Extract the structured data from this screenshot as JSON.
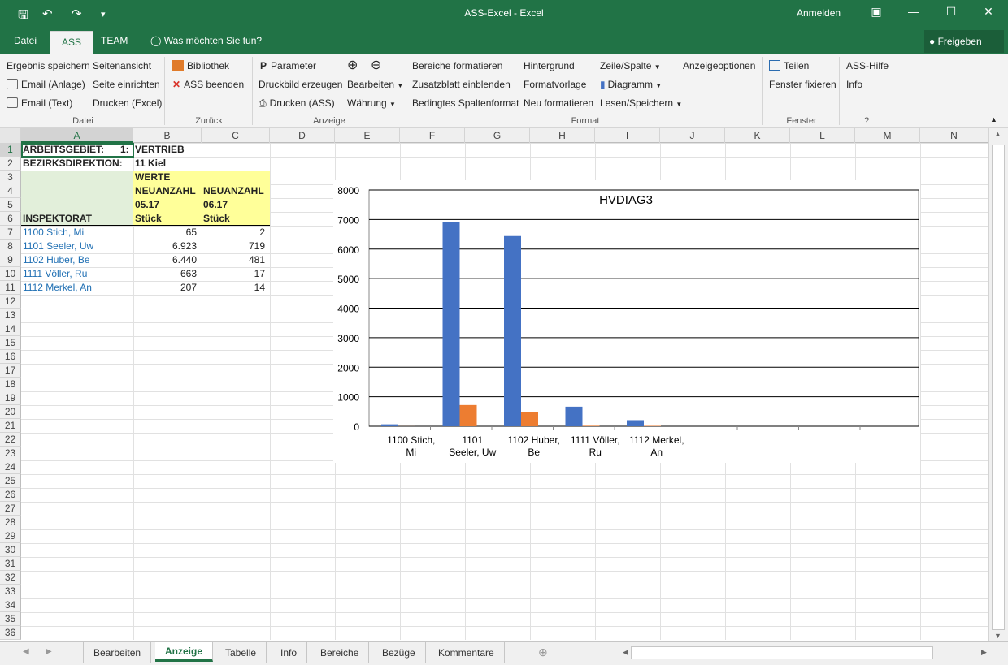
{
  "window": {
    "title": "ASS-Excel  -  Excel",
    "login": "Anmelden"
  },
  "tabs": {
    "file": "Datei",
    "ass": "ASS",
    "team": "TEAM",
    "tell": "Was möchten Sie tun?",
    "share": "Freigeben"
  },
  "ribbon": {
    "datei": {
      "b1": "Ergebnis speichern",
      "b2": "Email (Anlage)",
      "b3": "Email (Text)",
      "b4": "Seitenansicht",
      "b5": "Seite einrichten",
      "b6": "Drucken (Excel)",
      "label": "Datei"
    },
    "zurueck": {
      "b1": "Bibliothek",
      "b2": "ASS beenden",
      "label": "Zurück"
    },
    "anzeige": {
      "b1": "Parameter",
      "b2": "Druckbild erzeugen",
      "b3": "Drucken (ASS)",
      "b4": "Bearbeiten",
      "b5": "Währung",
      "label": "Anzeige"
    },
    "format": {
      "b1": "Bereiche formatieren",
      "b2": "Zusatzblatt einblenden",
      "b3": "Bedingtes Spaltenformat",
      "b4": "Hintergrund",
      "b5": "Formatvorlage",
      "b6": "Neu formatieren",
      "b7": "Zeile/Spalte",
      "b8": "Diagramm",
      "b9": "Lesen/Speichern",
      "b10": "Anzeigeoptionen",
      "label": "Format"
    },
    "fenster": {
      "b1": "Teilen",
      "b2": "Fenster fixieren",
      "label": "Fenster"
    },
    "help": {
      "b1": "ASS-Hilfe",
      "b2": "Info",
      "label": "?"
    }
  },
  "columns": [
    "A",
    "B",
    "C",
    "D",
    "E",
    "F",
    "G",
    "H",
    "I",
    "J",
    "K",
    "L",
    "M",
    "N"
  ],
  "rows": [
    "1",
    "2",
    "3",
    "4",
    "5",
    "6",
    "7",
    "8",
    "9",
    "10",
    "11",
    "12",
    "13",
    "14",
    "15",
    "16",
    "17",
    "18",
    "19",
    "20",
    "21",
    "22",
    "23",
    "24",
    "25",
    "26",
    "27",
    "28",
    "29",
    "30",
    "31",
    "32",
    "33",
    "34",
    "35",
    "36"
  ],
  "sheet": {
    "a1": "ARBEITSGEBIET:",
    "a1n": "1:",
    "b1": "VERTRIEB",
    "a2": "BEZIRKSDIREKTION:",
    "b2": "11 Kiel",
    "b3": "WERTE",
    "b4": "NEUANZAHL",
    "c4": "NEUANZAHL",
    "b5": "05.17",
    "c5": "06.17",
    "a6": "INSPEKTORAT",
    "b6": "Stück",
    "c6": "Stück",
    "data": [
      {
        "name": "1100 Stich, Mi",
        "b": "65",
        "c": "2"
      },
      {
        "name": "1101 Seeler, Uw",
        "b": "6.923",
        "c": "719"
      },
      {
        "name": "1102 Huber, Be",
        "b": "6.440",
        "c": "481"
      },
      {
        "name": "1111 Völler, Ru",
        "b": "663",
        "c": "17"
      },
      {
        "name": "1112 Merkel, An",
        "b": "207",
        "c": "14"
      }
    ]
  },
  "chart_data": {
    "type": "bar",
    "title": "HVDIAG3",
    "categories": [
      "1100 Stich, Mi",
      "1101 Seeler, Uw",
      "1102 Huber, Be",
      "1111 Völler, Ru",
      "1112 Merkel, An"
    ],
    "series": [
      {
        "values": [
          65,
          6923,
          6440,
          663,
          207
        ],
        "color": "#4472c4"
      },
      {
        "values": [
          2,
          719,
          481,
          17,
          14
        ],
        "color": "#ed7d31"
      }
    ],
    "ylim": [
      0,
      8000
    ],
    "yticks": [
      "0",
      "1000",
      "2000",
      "3000",
      "4000",
      "5000",
      "6000",
      "7000",
      "8000"
    ],
    "grid": true
  },
  "sheettabs": [
    "Bearbeiten",
    "Anzeige",
    "Tabelle",
    "Info",
    "Bereiche",
    "Bezüge",
    "Kommentare"
  ],
  "active_tab": "Anzeige"
}
